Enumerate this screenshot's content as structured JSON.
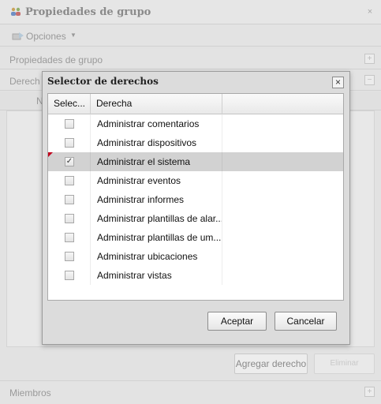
{
  "window": {
    "title": "Propiedades de grupo",
    "close_symbol": "×",
    "title_icon": "group-icon"
  },
  "toolbar": {
    "options_label": "Opciones",
    "options_caret": "▼",
    "options_icon": "options-icon"
  },
  "sections": {
    "group_properties": "Propiedades de grupo",
    "rights": "Derech",
    "rights_column_partial": "N",
    "members": "Miembros",
    "expand_symbol": "+",
    "collapse_symbol": "−"
  },
  "bottom_actions": {
    "add_right": "Agregar derecho",
    "remove": "Eliminar"
  },
  "dialog": {
    "title": "Selector de derechos",
    "close_symbol": "×",
    "columns": [
      "Selec...",
      "Derecha"
    ],
    "rows": [
      {
        "label": "Administrar comentarios",
        "checked": false
      },
      {
        "label": "Administrar dispositivos",
        "checked": false
      },
      {
        "label": "Administrar el sistema",
        "checked": true
      },
      {
        "label": "Administrar eventos",
        "checked": false
      },
      {
        "label": "Administrar informes",
        "checked": false
      },
      {
        "label": "Administrar plantillas de alar...",
        "checked": false
      },
      {
        "label": "Administrar plantillas de um...",
        "checked": false
      },
      {
        "label": "Administrar ubicaciones",
        "checked": false
      },
      {
        "label": "Administrar vistas",
        "checked": false
      }
    ],
    "check_symbol": "✓",
    "accept": "Aceptar",
    "cancel": "Cancelar"
  },
  "colors": {
    "dirty_marker": "#c0001c",
    "selected_row": "#d2d2d2"
  }
}
